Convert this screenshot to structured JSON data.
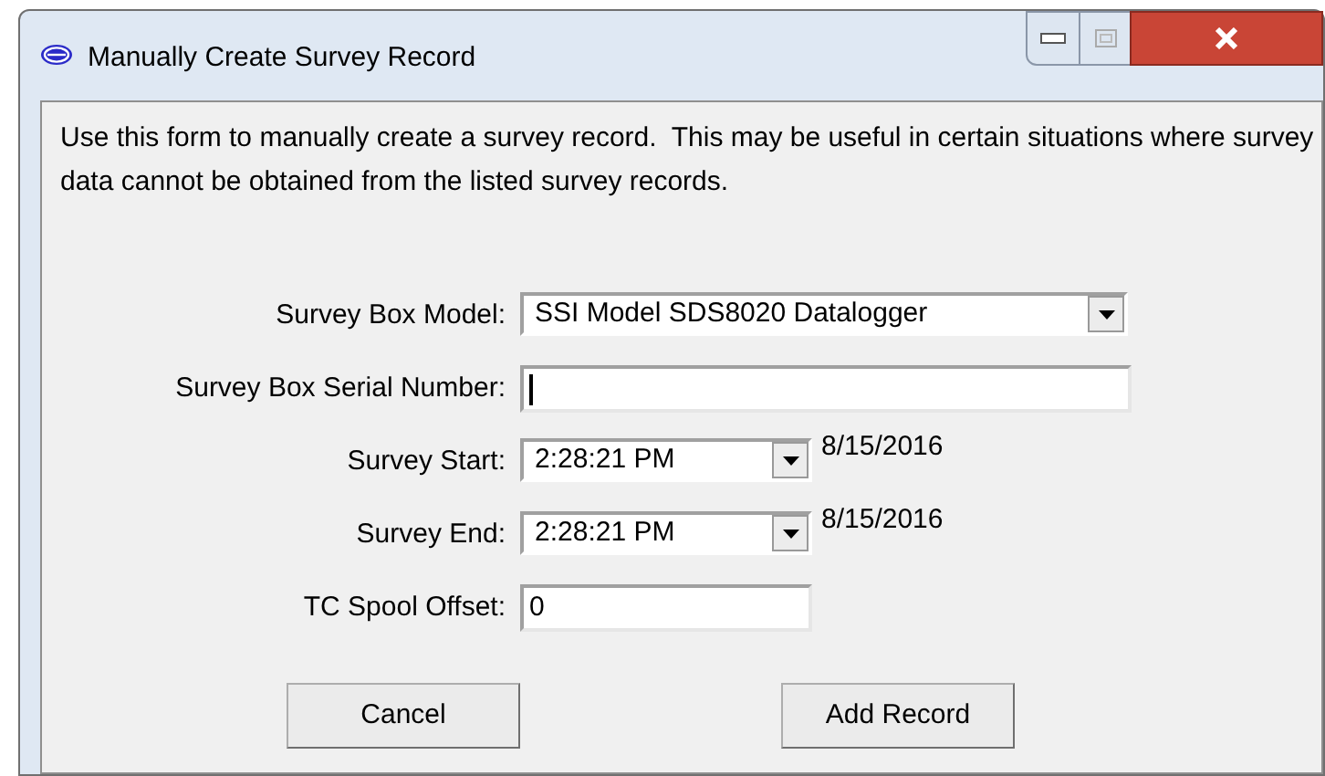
{
  "window": {
    "title": "Manually Create Survey Record"
  },
  "description": "Use this form to manually create a survey record.  This may be useful in certain situations where survey data cannot be obtained from the listed survey records.",
  "fields": [
    {
      "kind": "dropdown",
      "label": "Survey Box Model:",
      "value": "SSI Model SDS8020 Datalogger"
    },
    {
      "kind": "text",
      "label": "Survey Box Serial Number:",
      "focused": true
    },
    {
      "kind": "time",
      "label": "Survey Start:",
      "value": "2:28:21 PM",
      "date": "8/15/2016"
    },
    {
      "kind": "time",
      "label": "Survey End:",
      "value": "2:28:21 PM",
      "date": "8/15/2016"
    },
    {
      "kind": "short",
      "label": "TC Spool Offset:",
      "value": "0"
    }
  ],
  "buttons": [
    "Cancel",
    "Add Record"
  ]
}
